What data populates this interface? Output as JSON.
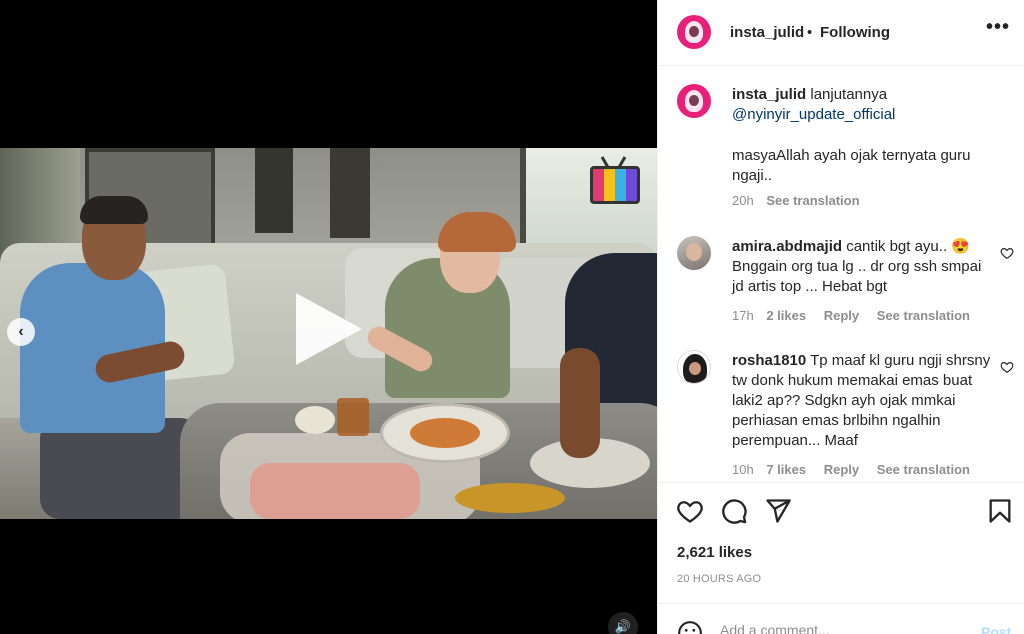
{
  "post": {
    "author": "insta_julid",
    "separator": "•",
    "follow_status": "Following",
    "more": "•••"
  },
  "caption": {
    "username": "insta_julid",
    "text": "lanjutannya",
    "mention": "@nyinyir_update_official",
    "body": "masyaAllah ayah ojak ternyata guru ngaji..",
    "time": "20h",
    "translate": "See translation"
  },
  "comments": [
    {
      "username": "amira.abdmajid",
      "text": "cantik bgt ayu.. 😍 Bnggain org tua lg .. dr org ssh smpai jd artis top ... Hebat bgt",
      "time": "17h",
      "likes": "2 likes",
      "reply": "Reply",
      "translate": "See translation"
    },
    {
      "username": "rosha1810",
      "text": "Tp maaf kl guru ngji shrsny tw donk hukum memakai emas buat laki2 ap?? Sdgkn ayh ojak mmkai perhiasan emas brlbihn ngalhin perempuan... Maaf",
      "time": "10h",
      "likes": "7 likes",
      "reply": "Reply",
      "translate": "See translation"
    }
  ],
  "actions": {
    "likes_count": "2,621 likes",
    "time_ago": "20 HOURS AGO"
  },
  "comment_box": {
    "placeholder": "Add a comment...",
    "post_label": "Post"
  },
  "media": {
    "prev_label": "‹",
    "sound_label": "🔊"
  },
  "colors": {
    "link": "#00376b",
    "muted": "#8e8e8e",
    "brand": "#e8207a"
  },
  "icons": [
    "heart-icon",
    "comment-icon",
    "share-icon",
    "bookmark-icon",
    "smiley-icon",
    "play-icon",
    "speaker-icon",
    "chevron-left-icon",
    "more-icon"
  ]
}
